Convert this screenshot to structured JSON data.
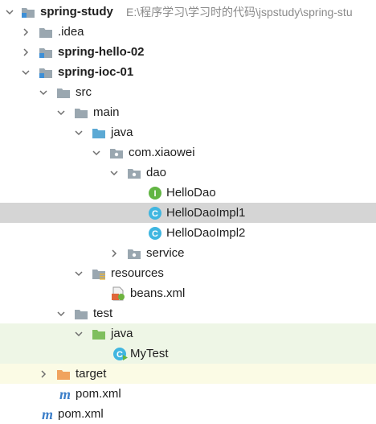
{
  "tree": {
    "rows": [
      {
        "label": "spring-study",
        "path": "E:\\程序学习\\学习时的代码\\jspstudy\\spring-stu",
        "icon": "module-folder-icon",
        "expanded": true,
        "bold": true
      },
      {
        "label": ".idea",
        "icon": "folder-icon",
        "expanded": false
      },
      {
        "label": "spring-hello-02",
        "icon": "module-folder-icon",
        "expanded": false,
        "bold": true
      },
      {
        "label": "spring-ioc-01",
        "icon": "module-folder-icon",
        "expanded": true,
        "bold": true
      },
      {
        "label": "src",
        "icon": "folder-icon",
        "expanded": true
      },
      {
        "label": "main",
        "icon": "folder-icon",
        "expanded": true
      },
      {
        "label": "java",
        "icon": "source-root-folder-icon",
        "expanded": true
      },
      {
        "label": "com.xiaowei",
        "icon": "package-icon",
        "expanded": true
      },
      {
        "label": "dao",
        "icon": "package-icon",
        "expanded": true
      },
      {
        "label": "HelloDao",
        "icon": "interface-icon"
      },
      {
        "label": "HelloDaoImpl1",
        "icon": "class-icon",
        "selected": true
      },
      {
        "label": "HelloDaoImpl2",
        "icon": "class-icon"
      },
      {
        "label": "service",
        "icon": "package-icon",
        "expanded": false
      },
      {
        "label": "resources",
        "icon": "resources-folder-icon",
        "expanded": true
      },
      {
        "label": "beans.xml",
        "icon": "spring-xml-icon"
      },
      {
        "label": "test",
        "icon": "folder-icon",
        "expanded": true
      },
      {
        "label": "java",
        "icon": "test-source-folder-icon",
        "expanded": true
      },
      {
        "label": "MyTest",
        "icon": "test-class-icon"
      },
      {
        "label": "target",
        "icon": "excluded-folder-icon",
        "expanded": false
      },
      {
        "label": "pom.xml",
        "icon": "maven-icon"
      },
      {
        "label": "pom.xml",
        "icon": "maven-icon"
      }
    ]
  },
  "colors": {
    "selection": "#d5d5d5",
    "test_highlight": "#eef6e6",
    "target_highlight": "#fbfbe5",
    "folder": "#9aa7b0",
    "source_root": "#5ca9d4",
    "test_root": "#7fbf5e",
    "excluded": "#f0a35e",
    "class": "#40b6e0",
    "interface": "#62b543"
  }
}
